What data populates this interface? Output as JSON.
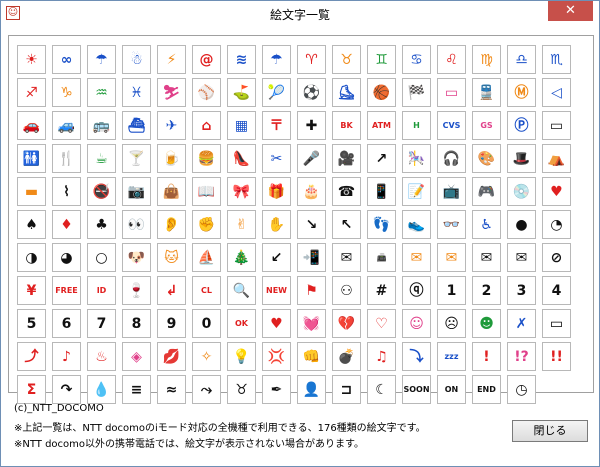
{
  "window": {
    "title": "絵文字一覧",
    "close_glyph": "✕"
  },
  "icons": [
    {
      "g": "☀",
      "c": "red"
    },
    {
      "g": "∞",
      "c": "blue"
    },
    {
      "g": "☂",
      "c": "blue"
    },
    {
      "g": "☃",
      "c": "blue"
    },
    {
      "g": "⚡",
      "c": "orange"
    },
    {
      "g": "@",
      "c": "red"
    },
    {
      "g": "≋",
      "c": "blue"
    },
    {
      "g": "☂",
      "c": "blue"
    },
    {
      "g": "♈",
      "c": "red"
    },
    {
      "g": "♉",
      "c": "orange"
    },
    {
      "g": "♊",
      "c": "green"
    },
    {
      "g": "♋",
      "c": "blue"
    },
    {
      "g": "♌",
      "c": "red"
    },
    {
      "g": "♍",
      "c": "orange"
    },
    {
      "g": "♎",
      "c": "blue"
    },
    {
      "g": "♏",
      "c": "blue"
    },
    {
      "g": "♐",
      "c": "red"
    },
    {
      "g": "♑",
      "c": "orange"
    },
    {
      "g": "♒",
      "c": "green"
    },
    {
      "g": "♓",
      "c": "blue"
    },
    {
      "g": "⛷",
      "c": "pink"
    },
    {
      "g": "⚾",
      "c": "black"
    },
    {
      "g": "⛳",
      "c": "green"
    },
    {
      "g": "🎾",
      "c": "green"
    },
    {
      "g": "⚽",
      "c": "black"
    },
    {
      "g": "⛸",
      "c": "blue"
    },
    {
      "g": "🏀",
      "c": "orange"
    },
    {
      "g": "🏁",
      "c": "black"
    },
    {
      "g": "▭",
      "c": "pink"
    },
    {
      "g": "🚆",
      "c": "green"
    },
    {
      "g": "Ⓜ",
      "c": "orange"
    },
    {
      "g": "◁",
      "c": "blue"
    },
    {
      "g": "🚗",
      "c": "black"
    },
    {
      "g": "🚙",
      "c": "green"
    },
    {
      "g": "🚌",
      "c": "red"
    },
    {
      "g": "⛴",
      "c": "blue"
    },
    {
      "g": "✈",
      "c": "blue"
    },
    {
      "g": "⌂",
      "c": "red"
    },
    {
      "g": "▦",
      "c": "blue"
    },
    {
      "g": "〒",
      "c": "red"
    },
    {
      "g": "✚",
      "c": "black"
    },
    {
      "g": "BK",
      "c": "red",
      "small": true
    },
    {
      "g": "ATM",
      "c": "red",
      "small": true
    },
    {
      "g": "H",
      "c": "green",
      "small": true
    },
    {
      "g": "CVS",
      "c": "blue",
      "small": true
    },
    {
      "g": "GS",
      "c": "pink",
      "small": true
    },
    {
      "g": "Ⓟ",
      "c": "blue"
    },
    {
      "g": "▭",
      "c": "black"
    },
    {
      "g": "🚻",
      "c": "black"
    },
    {
      "g": "🍴",
      "c": "black"
    },
    {
      "g": "☕",
      "c": "green"
    },
    {
      "g": "🍸",
      "c": "pink"
    },
    {
      "g": "🍺",
      "c": "orange"
    },
    {
      "g": "🍔",
      "c": "orange"
    },
    {
      "g": "👠",
      "c": "pink"
    },
    {
      "g": "✂",
      "c": "blue"
    },
    {
      "g": "🎤",
      "c": "black"
    },
    {
      "g": "🎥",
      "c": "black"
    },
    {
      "g": "↗",
      "c": "black"
    },
    {
      "g": "🎠",
      "c": "orange"
    },
    {
      "g": "🎧",
      "c": "blue"
    },
    {
      "g": "🎨",
      "c": "pink"
    },
    {
      "g": "🎩",
      "c": "black"
    },
    {
      "g": "⛺",
      "c": "red"
    },
    {
      "g": "▬",
      "c": "orange"
    },
    {
      "g": "⌇",
      "c": "black"
    },
    {
      "g": "🚭",
      "c": "red"
    },
    {
      "g": "📷",
      "c": "black"
    },
    {
      "g": "👜",
      "c": "red"
    },
    {
      "g": "📖",
      "c": "orange"
    },
    {
      "g": "🎀",
      "c": "red"
    },
    {
      "g": "🎁",
      "c": "red"
    },
    {
      "g": "🎂",
      "c": "red"
    },
    {
      "g": "☎",
      "c": "black"
    },
    {
      "g": "📱",
      "c": "black"
    },
    {
      "g": "📝",
      "c": "orange"
    },
    {
      "g": "📺",
      "c": "black"
    },
    {
      "g": "🎮",
      "c": "black"
    },
    {
      "g": "💿",
      "c": "blue"
    },
    {
      "g": "♥",
      "c": "red"
    },
    {
      "g": "♠",
      "c": "black"
    },
    {
      "g": "♦",
      "c": "red"
    },
    {
      "g": "♣",
      "c": "black"
    },
    {
      "g": "👀",
      "c": "black"
    },
    {
      "g": "👂",
      "c": "orange"
    },
    {
      "g": "✊",
      "c": "orange"
    },
    {
      "g": "✌",
      "c": "orange"
    },
    {
      "g": "✋",
      "c": "orange"
    },
    {
      "g": "↘",
      "c": "black"
    },
    {
      "g": "↖",
      "c": "black"
    },
    {
      "g": "👣",
      "c": "orange"
    },
    {
      "g": "👟",
      "c": "black"
    },
    {
      "g": "👓",
      "c": "black"
    },
    {
      "g": "♿",
      "c": "blue"
    },
    {
      "g": "●",
      "c": "black"
    },
    {
      "g": "◔",
      "c": "black"
    },
    {
      "g": "◑",
      "c": "black"
    },
    {
      "g": "◕",
      "c": "black"
    },
    {
      "g": "○",
      "c": "black"
    },
    {
      "g": "🐶",
      "c": "orange"
    },
    {
      "g": "🐱",
      "c": "orange"
    },
    {
      "g": "⛵",
      "c": "green"
    },
    {
      "g": "🎄",
      "c": "green"
    },
    {
      "g": "↙",
      "c": "black"
    },
    {
      "g": "📲",
      "c": "black"
    },
    {
      "g": "✉",
      "c": "black"
    },
    {
      "g": "📠",
      "c": "black",
      "small": true
    },
    {
      "g": "✉",
      "c": "orange"
    },
    {
      "g": "✉",
      "c": "orange"
    },
    {
      "g": "✉",
      "c": "black"
    },
    {
      "g": "✉",
      "c": "black"
    },
    {
      "g": "⊘",
      "c": "black"
    },
    {
      "g": "¥",
      "c": "red"
    },
    {
      "g": "FREE",
      "c": "red",
      "small": true
    },
    {
      "g": "ID",
      "c": "red",
      "small": true
    },
    {
      "g": "🍷",
      "c": "red"
    },
    {
      "g": "↲",
      "c": "red"
    },
    {
      "g": "CL",
      "c": "red",
      "small": true
    },
    {
      "g": "🔍",
      "c": "blue"
    },
    {
      "g": "NEW",
      "c": "red",
      "small": true
    },
    {
      "g": "⚑",
      "c": "red"
    },
    {
      "g": "⚇",
      "c": "black"
    },
    {
      "g": "#",
      "c": "black"
    },
    {
      "g": "ⓠ",
      "c": "black"
    },
    {
      "g": "1",
      "c": "black"
    },
    {
      "g": "2",
      "c": "black"
    },
    {
      "g": "3",
      "c": "black"
    },
    {
      "g": "4",
      "c": "black"
    },
    {
      "g": "5",
      "c": "black"
    },
    {
      "g": "6",
      "c": "black"
    },
    {
      "g": "7",
      "c": "black"
    },
    {
      "g": "8",
      "c": "black"
    },
    {
      "g": "9",
      "c": "black"
    },
    {
      "g": "0",
      "c": "black"
    },
    {
      "g": "OK",
      "c": "red",
      "small": true
    },
    {
      "g": "♥",
      "c": "red"
    },
    {
      "g": "💓",
      "c": "red"
    },
    {
      "g": "💔",
      "c": "red"
    },
    {
      "g": "♡",
      "c": "red"
    },
    {
      "g": "☺",
      "c": "pink"
    },
    {
      "g": "☹",
      "c": "black"
    },
    {
      "g": "☻",
      "c": "green"
    },
    {
      "g": "✗",
      "c": "blue"
    },
    {
      "g": "▭",
      "c": "white"
    },
    {
      "g": "⤴",
      "c": "red"
    },
    {
      "g": "♪",
      "c": "red"
    },
    {
      "g": "♨",
      "c": "red"
    },
    {
      "g": "◈",
      "c": "pink"
    },
    {
      "g": "💋",
      "c": "red"
    },
    {
      "g": "✧",
      "c": "orange"
    },
    {
      "g": "💡",
      "c": "orange"
    },
    {
      "g": "💢",
      "c": "black"
    },
    {
      "g": "👊",
      "c": "red"
    },
    {
      "g": "💣",
      "c": "black"
    },
    {
      "g": "♫",
      "c": "red"
    },
    {
      "g": "⤵",
      "c": "blue"
    },
    {
      "g": "zzz",
      "c": "blue",
      "small": true
    },
    {
      "g": "!",
      "c": "red"
    },
    {
      "g": "!?",
      "c": "pink"
    },
    {
      "g": "!!",
      "c": "red"
    },
    {
      "g": "Σ",
      "c": "red"
    },
    {
      "g": "↷",
      "c": "black"
    },
    {
      "g": "💧",
      "c": "black"
    },
    {
      "g": "≡",
      "c": "black"
    },
    {
      "g": "≈",
      "c": "black"
    },
    {
      "g": "⤳",
      "c": "black"
    },
    {
      "g": "♉",
      "c": "black"
    },
    {
      "g": "✒",
      "c": "black"
    },
    {
      "g": "👤",
      "c": "black"
    },
    {
      "g": "⊐",
      "c": "black"
    },
    {
      "g": "☾",
      "c": "black"
    },
    {
      "g": "SOON",
      "c": "black",
      "small": true
    },
    {
      "g": "ON",
      "c": "black",
      "small": true
    },
    {
      "g": "END",
      "c": "black",
      "small": true
    },
    {
      "g": "◷",
      "c": "black"
    }
  ],
  "footer": {
    "copyright": "(c)_NTT_DOCOMO",
    "note1": "※上記一覧は、NTT docomoのiモード対応の全機種で利用できる、176種類の絵文字です。",
    "note2": "※NTT docomo以外の携帯電話では、絵文字が表示されない場合があります。"
  },
  "buttons": {
    "close_label": "閉じる"
  }
}
